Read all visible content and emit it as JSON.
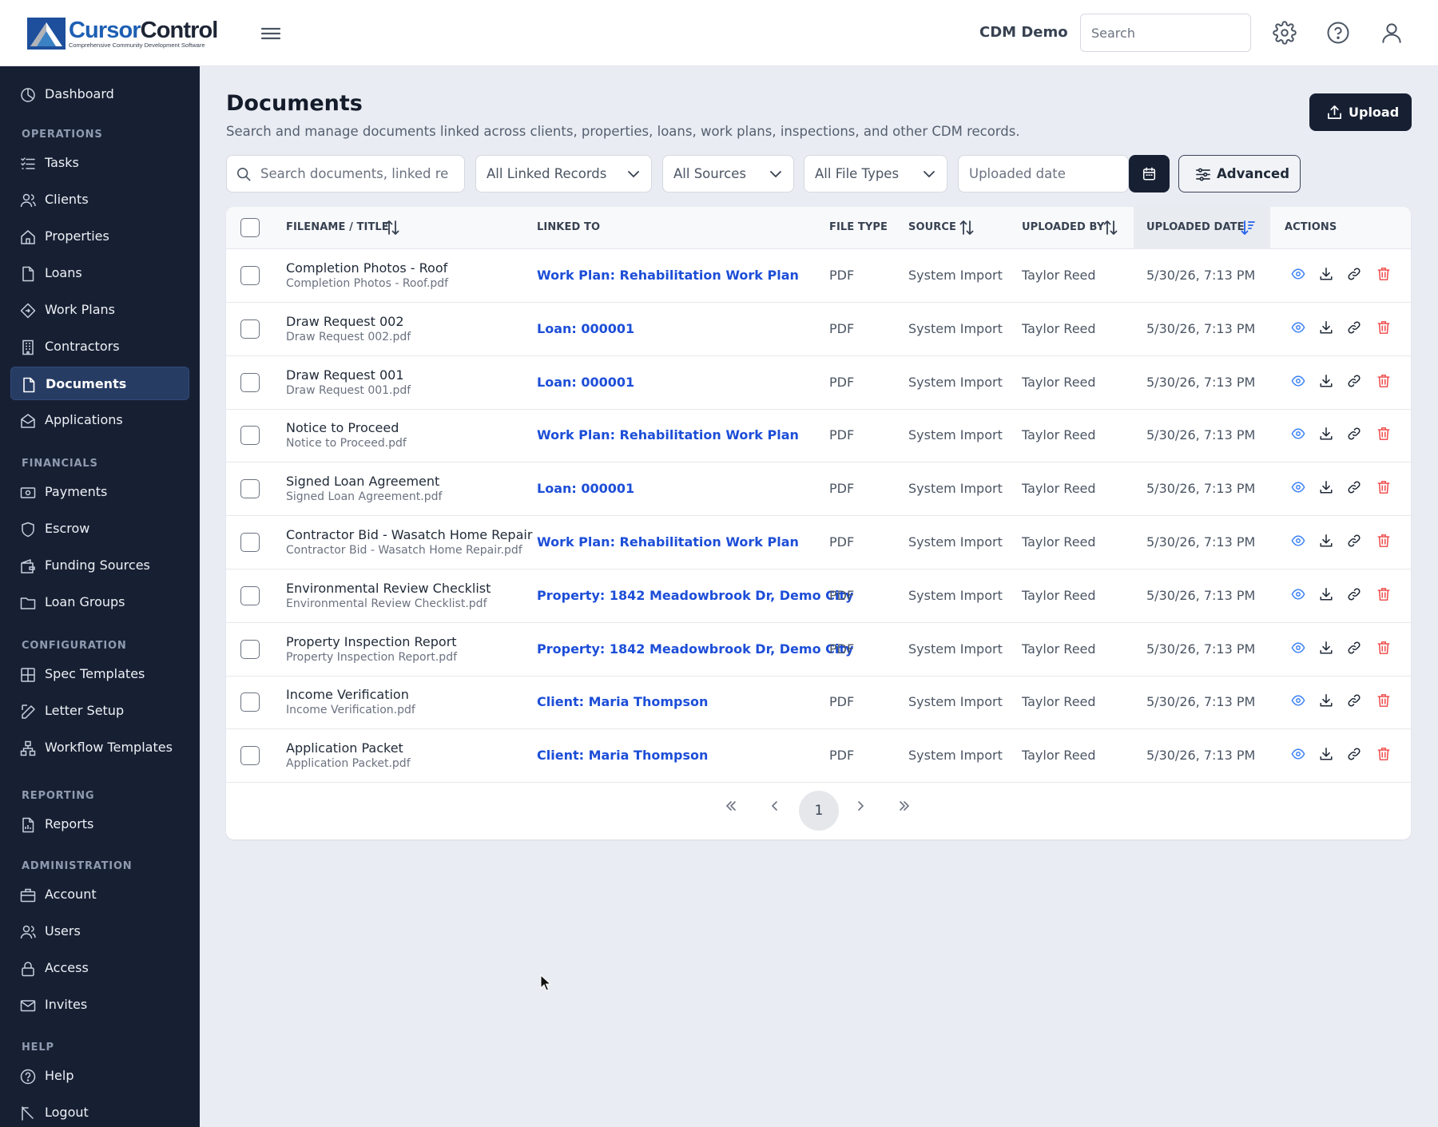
{
  "brand": {
    "name_part1": "Cursor",
    "name_part2": "Control",
    "tagline": "Comprehensive Community Development Software"
  },
  "topbar": {
    "org_name": "CDM Demo",
    "search_placeholder": "Search",
    "icons": [
      "menu-icon",
      "gear-icon",
      "help-icon",
      "user-icon"
    ]
  },
  "sidebar": {
    "dashboard": "Dashboard",
    "sections": {
      "operations": "OPERATIONS",
      "financials": "FINANCIALS",
      "configuration": "CONFIGURATION",
      "reporting": "REPORTING",
      "administration": "ADMINISTRATION",
      "help": "HELP"
    },
    "items": {
      "tasks": "Tasks",
      "clients": "Clients",
      "properties": "Properties",
      "loans": "Loans",
      "work_plans": "Work Plans",
      "contractors": "Contractors",
      "documents": "Documents",
      "applications": "Applications",
      "payments": "Payments",
      "escrow": "Escrow",
      "funding_sources": "Funding Sources",
      "loan_groups": "Loan Groups",
      "spec_templates": "Spec Templates",
      "letter_setup": "Letter Setup",
      "workflow_templates": "Workflow Templates",
      "reports": "Reports",
      "account": "Account",
      "users": "Users",
      "access": "Access",
      "invites": "Invites",
      "help": "Help",
      "logout": "Logout"
    },
    "active": "Documents"
  },
  "page": {
    "title": "Documents",
    "subtitle": "Search and manage documents linked across clients, properties, loans, work plans, inspections, and other CDM records.",
    "upload_label": "Upload"
  },
  "filters": {
    "search_placeholder": "Search documents, linked records",
    "search_visible": "Search documents, linked re",
    "linked_records": "All Linked Records",
    "sources": "All Sources",
    "file_types": "All File Types",
    "date_placeholder": "Uploaded date",
    "advanced_label": "Advanced"
  },
  "table": {
    "columns": {
      "filename": "FILENAME / TITLE",
      "linked_to": "LINKED TO",
      "file_type": "FILE TYPE",
      "source": "SOURCE",
      "uploaded_by": "UPLOADED BY",
      "uploaded_date": "UPLOADED DATE",
      "actions": "ACTIONS"
    },
    "sorted_column": "UPLOADED DATE",
    "rows": [
      {
        "title": "Completion Photos - Roof",
        "filename": "Completion Photos - Roof.pdf",
        "linked_to": "Work Plan: Rehabilitation Work Plan",
        "file_type": "PDF",
        "source": "System Import",
        "uploaded_by": "Taylor Reed",
        "uploaded_date": "5/30/26, 7:13 PM"
      },
      {
        "title": "Draw Request 002",
        "filename": "Draw Request 002.pdf",
        "linked_to": "Loan: 000001",
        "file_type": "PDF",
        "source": "System Import",
        "uploaded_by": "Taylor Reed",
        "uploaded_date": "5/30/26, 7:13 PM"
      },
      {
        "title": "Draw Request 001",
        "filename": "Draw Request 001.pdf",
        "linked_to": "Loan: 000001",
        "file_type": "PDF",
        "source": "System Import",
        "uploaded_by": "Taylor Reed",
        "uploaded_date": "5/30/26, 7:13 PM"
      },
      {
        "title": "Notice to Proceed",
        "filename": "Notice to Proceed.pdf",
        "linked_to": "Work Plan: Rehabilitation Work Plan",
        "file_type": "PDF",
        "source": "System Import",
        "uploaded_by": "Taylor Reed",
        "uploaded_date": "5/30/26, 7:13 PM"
      },
      {
        "title": "Signed Loan Agreement",
        "filename": "Signed Loan Agreement.pdf",
        "linked_to": "Loan: 000001",
        "file_type": "PDF",
        "source": "System Import",
        "uploaded_by": "Taylor Reed",
        "uploaded_date": "5/30/26, 7:13 PM"
      },
      {
        "title": "Contractor Bid - Wasatch Home Repair",
        "filename": "Contractor Bid - Wasatch Home Repair.pdf",
        "linked_to": "Work Plan: Rehabilitation Work Plan",
        "file_type": "PDF",
        "source": "System Import",
        "uploaded_by": "Taylor Reed",
        "uploaded_date": "5/30/26, 7:13 PM"
      },
      {
        "title": "Environmental Review Checklist",
        "filename": "Environmental Review Checklist.pdf",
        "linked_to": "Property: 1842 Meadowbrook Dr, Demo City",
        "file_type": "PDF",
        "source": "System Import",
        "uploaded_by": "Taylor Reed",
        "uploaded_date": "5/30/26, 7:13 PM"
      },
      {
        "title": "Property Inspection Report",
        "filename": "Property Inspection Report.pdf",
        "linked_to": "Property: 1842 Meadowbrook Dr, Demo City",
        "file_type": "PDF",
        "source": "System Import",
        "uploaded_by": "Taylor Reed",
        "uploaded_date": "5/30/26, 7:13 PM"
      },
      {
        "title": "Income Verification",
        "filename": "Income Verification.pdf",
        "linked_to": "Client: Maria Thompson",
        "file_type": "PDF",
        "source": "System Import",
        "uploaded_by": "Taylor Reed",
        "uploaded_date": "5/30/26, 7:13 PM"
      },
      {
        "title": "Application Packet",
        "filename": "Application Packet.pdf",
        "linked_to": "Client: Maria Thompson",
        "file_type": "PDF",
        "source": "System Import",
        "uploaded_by": "Taylor Reed",
        "uploaded_date": "5/30/26, 7:13 PM"
      }
    ],
    "row_action_icons": [
      "eye-icon",
      "download-icon",
      "link-icon",
      "trash-icon"
    ]
  },
  "pagination": {
    "current_page": "1"
  },
  "colors": {
    "sidebar_bg": "#172033",
    "active_item_bg": "#263c63",
    "link_blue": "#1d4ed8",
    "delete_red": "#ef4444",
    "primary_button": "#172033",
    "page_bg": "#e9ecf2"
  }
}
